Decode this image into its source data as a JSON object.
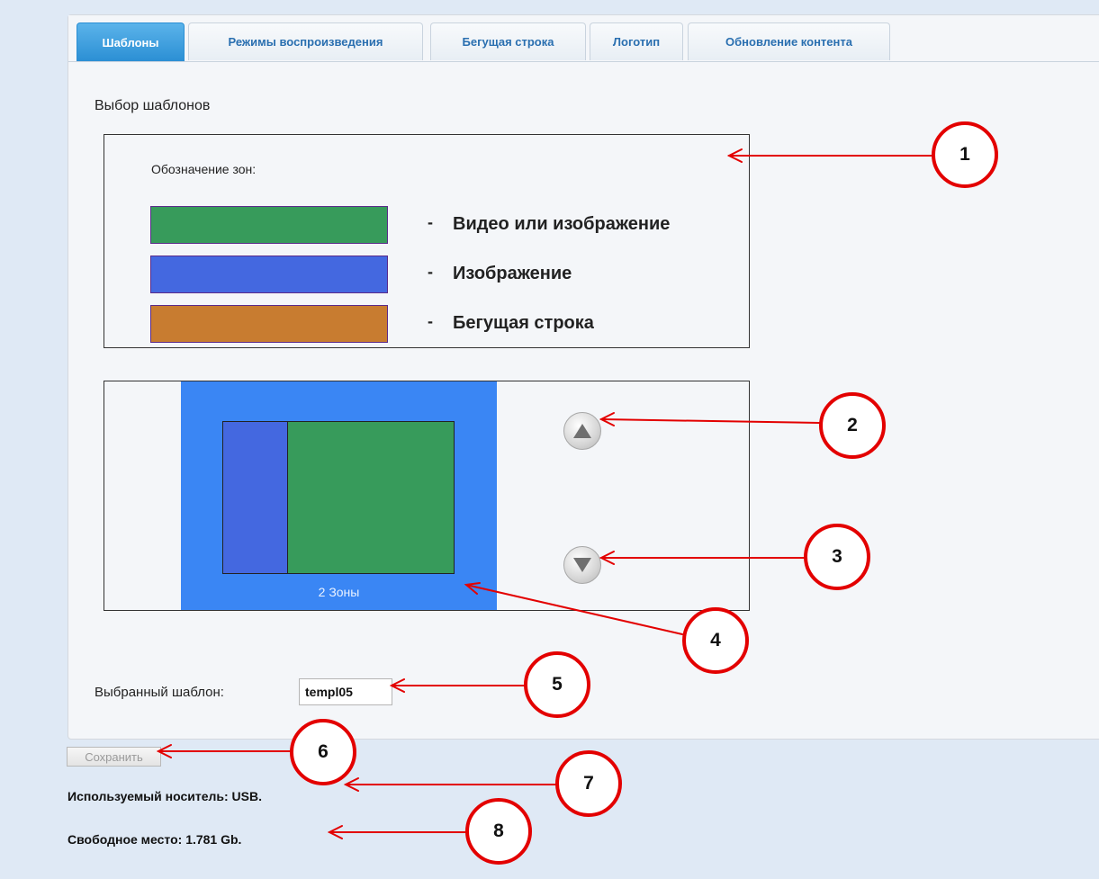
{
  "tabs": [
    {
      "label": "Шаблоны",
      "active": true
    },
    {
      "label": "Режимы воспроизведения",
      "active": false
    },
    {
      "label": "Бегущая строка",
      "active": false
    },
    {
      "label": "Логотип",
      "active": false
    },
    {
      "label": "Обновление контента",
      "active": false
    }
  ],
  "section_title": "Выбор шаблонов",
  "legend": {
    "heading": "Обозначение зон:",
    "dash": "-",
    "items": [
      {
        "label": "Видео или изображение",
        "color": "#379b5b"
      },
      {
        "label": "Изображение",
        "color": "#4468e0"
      },
      {
        "label": "Бегущая строка",
        "color": "#c87c30"
      }
    ]
  },
  "template_preview": {
    "caption": "2 Зоны",
    "background_color": "#3a86f4",
    "zones": [
      "Изображение",
      "Видео или изображение"
    ]
  },
  "selected_template": {
    "label": "Выбранный шаблон:",
    "value": "templ05"
  },
  "save_button": "Сохранить",
  "storage": {
    "medium": "Используемый носитель: USB.",
    "free_space": "Свободное место: 1.781 Gb."
  },
  "callouts": [
    "1",
    "2",
    "3",
    "4",
    "5",
    "6",
    "7",
    "8"
  ],
  "colors": {
    "accent": "#2b8fd4",
    "callout": "#e30000"
  }
}
